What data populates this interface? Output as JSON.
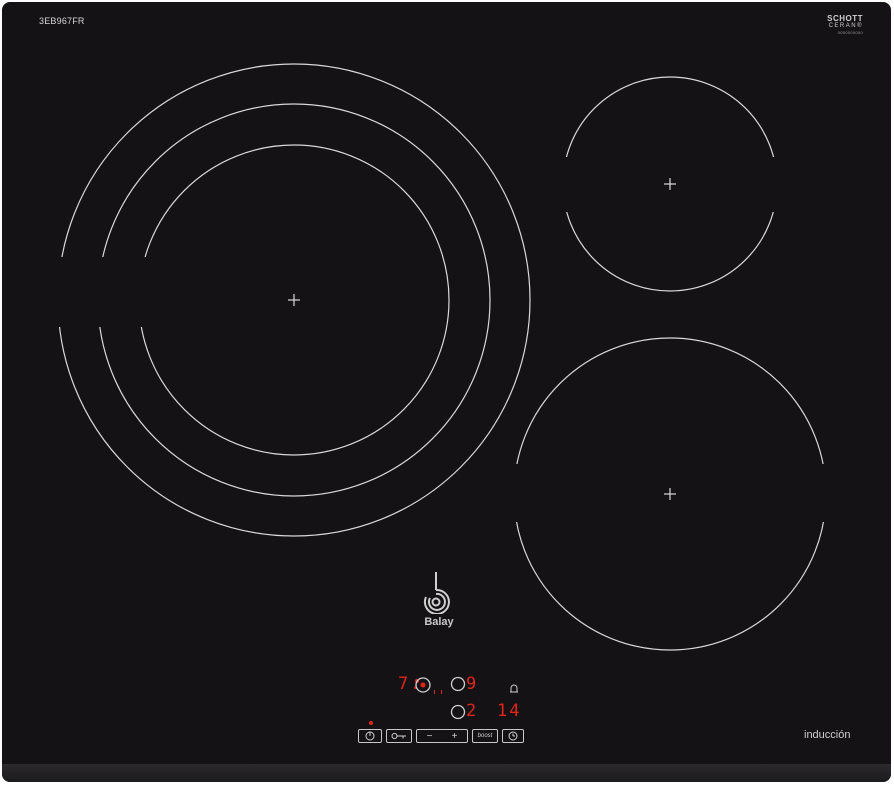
{
  "product": {
    "model": "3EB967FR",
    "glass_brand_line1": "SCHOTT",
    "glass_brand_line2": "CERAN®",
    "glass_brand_fineprint": "0000000000",
    "brand": "Balay",
    "technology_label": "inducción"
  },
  "controls": {
    "zone_left_level": "7.",
    "zone_right_top_level": "9",
    "zone_right_bottom_level": "2",
    "timer_value": "14",
    "buttons": {
      "power": "power-icon",
      "lock": "key-icon",
      "minus": "−",
      "plus": "+",
      "boost": "boost",
      "timer": "clock-icon"
    }
  },
  "colors": {
    "glass": "#141214",
    "ring": "#d9d9d9",
    "display_red": "#e0241c"
  }
}
